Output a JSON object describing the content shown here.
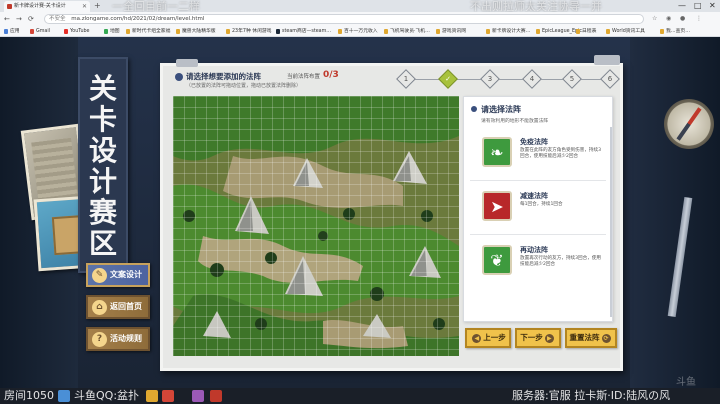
{
  "browser": {
    "tab_title": "新卡牌设计赛-关卡设计",
    "new_tab": "+",
    "url": "ma.zlongame.com/hd/2021/02/dream/level.html",
    "security_label": "不安全",
    "window_controls": [
      "—",
      "□",
      "✕"
    ],
    "overlay_left": "一全回目前一二样",
    "overlay_right": "不出则拉师太关注协导一并",
    "bookmarks": [
      {
        "label": "应用",
        "color": "#4a7fd6"
      },
      {
        "label": "Gmail",
        "color": "#d44638"
      },
      {
        "label": "YouTube",
        "color": "#e52d27"
      },
      {
        "label": "地图",
        "color": "#34a853"
      },
      {
        "label": "新时代卡组全家福",
        "color": "#e0a830"
      },
      {
        "label": "魔兽大陆精华版",
        "color": "#e0a830"
      },
      {
        "label": "23年7种 休闲游戏",
        "color": "#e0a830"
      },
      {
        "label": "steam商店—steam…",
        "color": "#1b2838"
      },
      {
        "label": "百十一万元收入",
        "color": "#e0a830"
      },
      {
        "label": "飞机驾驶员·飞机…",
        "color": "#e0a830"
      },
      {
        "label": "游戏资讯网",
        "color": "#e0a830"
      },
      {
        "label": "新卡牌设计大赛…",
        "color": "#e0a830"
      },
      {
        "label": "EpicLeague_Epic…",
        "color": "#e0a830"
      },
      {
        "label": "日程表",
        "color": "#e0a830"
      },
      {
        "label": "World资讯工具",
        "color": "#e0a830"
      },
      {
        "label": "我…查页…",
        "color": "#e0a830"
      }
    ]
  },
  "banner": {
    "title_chars": [
      "关",
      "卡",
      "设",
      "计",
      "赛",
      "区"
    ]
  },
  "side_nav": [
    {
      "label": "文案设计",
      "icon": "✎",
      "state": "active"
    },
    {
      "label": "返回首页",
      "icon": "⌂",
      "state": "normal"
    },
    {
      "label": "活动规则",
      "icon": "?",
      "state": "normal"
    }
  ],
  "panel": {
    "heading": "请选择想要添加的法阵",
    "count_label": "当前法阵布置",
    "count_value": "0/3",
    "hint": "（已放置的法阵可拖动位置，拖动已放置法阵删除）",
    "steps": [
      {
        "label": "1",
        "done": false
      },
      {
        "label": "✓",
        "done": true
      },
      {
        "label": "3",
        "done": false
      },
      {
        "label": "4",
        "done": false
      },
      {
        "label": "5",
        "done": false
      },
      {
        "label": "6",
        "done": false
      }
    ]
  },
  "list": {
    "title": "请选择法阵",
    "subtitle": "请有效利用的地形不能放置法阵",
    "items": [
      {
        "name": "免疫法阵",
        "desc": "放置在此阵的友方角色受到伤害，持续3回合，使用技能后减少2回合",
        "icon": "❧",
        "color": "#3e9a3e"
      },
      {
        "name": "减速法阵",
        "desc": "每1回合，持续1回合",
        "icon": "➤",
        "color": "#b8282a"
      },
      {
        "name": "再动法阵",
        "desc": "放置再次行动的友方，持续3回合，使用技能后减少2回合",
        "icon": "❦",
        "color": "#3e9a3e"
      }
    ]
  },
  "buttons": {
    "prev": "上一步",
    "next": "下一步",
    "reset": "重置法阵"
  },
  "corner_mark": "斗鱼",
  "taskbar": {
    "left_text": "房间1050",
    "mid_text": "斗鱼QQ:盆扑",
    "right_text": "服务器:官服 拉卡斯·ID:陆风の风"
  }
}
